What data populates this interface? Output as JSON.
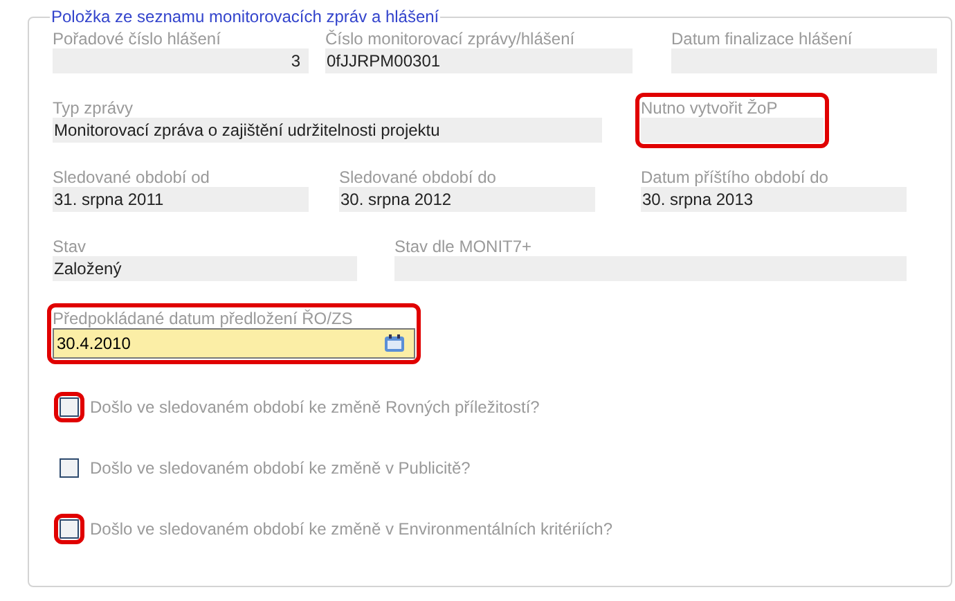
{
  "legend": "Položka ze seznamu monitorovacích zpráv a hlášení",
  "rows": [
    [
      {
        "label": "Pořadové číslo hlášení",
        "value": "3",
        "kind": "number",
        "highlighted": false
      },
      {
        "label": "Číslo monitorovací zprávy/hlášení",
        "value": "0fJJRPM00301",
        "kind": "text",
        "highlighted": false
      },
      {
        "label": "Datum finalizace hlášení",
        "kind": "text",
        "highlighted": false
      }
    ],
    [
      {
        "label": "Typ zprávy",
        "value": "Monitorovací zpráva o zajištění udržitelnosti projektu",
        "kind": "text",
        "highlighted": false
      },
      {
        "label": "Nutno vytvořit ŽoP",
        "kind": "text",
        "highlighted": true
      }
    ],
    [
      {
        "label": "Sledované období od",
        "value": "31. srpna 2011",
        "kind": "text",
        "highlighted": false
      },
      {
        "label": "Sledované období do",
        "value": "30. srpna 2012",
        "kind": "text",
        "highlighted": false
      },
      {
        "label": "Datum příštího období do",
        "value": "30. srpna 2013",
        "kind": "text",
        "highlighted": false
      }
    ],
    [
      {
        "label": "Stav",
        "value": "Založený",
        "kind": "text",
        "highlighted": false
      },
      {
        "label": "Stav dle MONIT7+",
        "kind": "text",
        "highlighted": false
      }
    ]
  ],
  "date_field": {
    "label": "Předpokládané datum předložení ŘO/ZS",
    "value": "30.4.2010",
    "highlighted": true
  },
  "checkboxes": [
    {
      "label": "Došlo ve sledovaném období ke změně Rovných příležitostí?",
      "checked": false,
      "highlighted": true
    },
    {
      "label": "Došlo ve sledovaném období ke změně v Publicitě?",
      "checked": false,
      "highlighted": false
    },
    {
      "label": "Došlo ve sledovaném období ke změně v Environmentálních kritériích?",
      "checked": false,
      "highlighted": true
    }
  ]
}
